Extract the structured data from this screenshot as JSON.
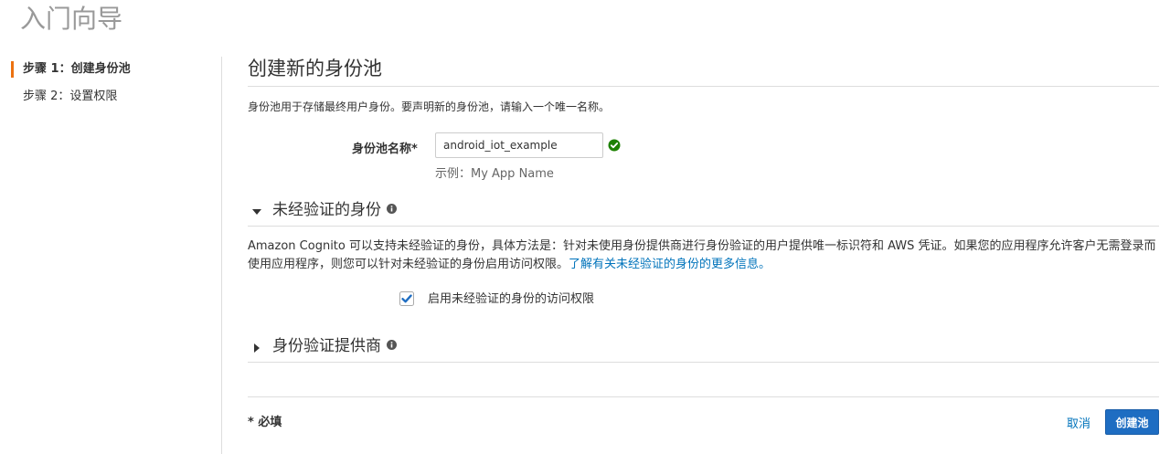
{
  "wizard": {
    "title": "入门向导"
  },
  "sidebar": {
    "steps": [
      {
        "label": "步骤 1：创建身份池"
      },
      {
        "label": "步骤 2：设置权限"
      }
    ]
  },
  "main": {
    "title": "创建新的身份池",
    "description": "身份池用于存储最终用户身份。要声明新的身份池，请输入一个唯一名称。",
    "pool_name": {
      "label": "身份池名称*",
      "value": "android_iot_example",
      "hint": "示例：My App Name"
    },
    "unauth_section": {
      "title": "未经验证的身份",
      "body_text": "Amazon Cognito 可以支持未经验证的身份，具体方法是：针对未使用身份提供商进行身份验证的用户提供唯一标识符和 AWS 凭证。如果您的应用程序允许客户无需登录而使用应用程序，则您可以针对未经验证的身份启用访问权限。",
      "learn_more_link": "了解有关未经验证的身份的更多信息。",
      "checkbox_label": "启用未经验证的身份的访问权限"
    },
    "providers_section": {
      "title": "身份验证提供商"
    },
    "footer": {
      "required_note": "* 必填",
      "cancel_label": "取消",
      "create_label": "创建池"
    }
  },
  "colors": {
    "accent": "#ec7211",
    "link": "#0073bb",
    "primary_button": "#1e6dc2",
    "valid": "#1d8102"
  },
  "icons": {
    "valid": "check-circle-icon",
    "info": "info-icon",
    "expanded": "caret-down-icon",
    "collapsed": "caret-right-icon",
    "checkbox": "checkmark-icon"
  }
}
